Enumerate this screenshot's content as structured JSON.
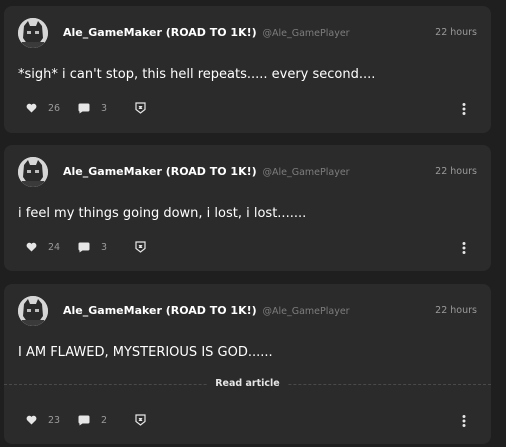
{
  "posts": [
    {
      "author": "Ale_GameMaker (ROAD TO 1K!)",
      "handle": "@Ale_GamePlayer",
      "time": "22 hours",
      "text": "*sigh* i can't stop, this hell repeats..... every second....",
      "likes": "26",
      "comments": "3"
    },
    {
      "author": "Ale_GameMaker (ROAD TO 1K!)",
      "handle": "@Ale_GamePlayer",
      "time": "22 hours",
      "text": "i feel my things going down, i lost, i lost.......",
      "likes": "24",
      "comments": "3"
    },
    {
      "author": "Ale_GameMaker (ROAD TO 1K!)",
      "handle": "@Ale_GamePlayer",
      "time": "22 hours",
      "text": "I AM FLAWED, MYSTERIOUS IS GOD......",
      "likes": "23",
      "comments": "2",
      "read_more_label": "Read article"
    }
  ],
  "icons": {
    "like": "heart-icon",
    "comment": "comment-bubble-icon",
    "reward": "reward-icon",
    "more": "more-options-icon"
  },
  "colors": {
    "background": "#1f1f1f",
    "card": "#2b2b2b",
    "muted_text": "#9a9a9a"
  }
}
